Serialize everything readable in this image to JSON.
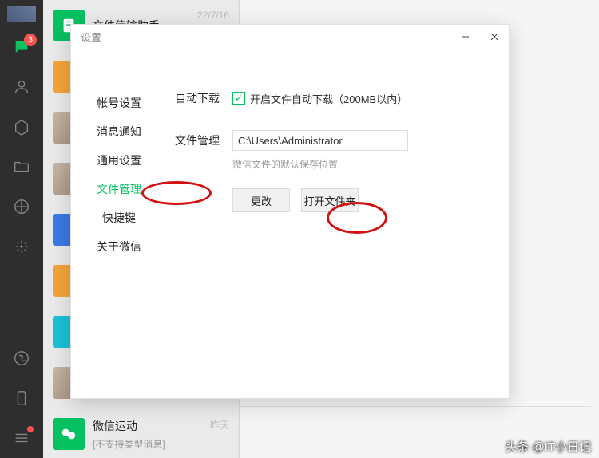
{
  "rail": {
    "badge": "3"
  },
  "chat_list": [
    {
      "name": "文件传输助手",
      "time": "22/7/16"
    },
    {
      "name": "微信运动",
      "sub": "[不支持类型消息]",
      "time": "昨天"
    }
  ],
  "settings": {
    "title": "设置",
    "nav": [
      "帐号设置",
      "消息通知",
      "通用设置",
      "文件管理",
      "快捷键",
      "关于微信"
    ],
    "active_nav": 3,
    "auto_download": {
      "label": "自动下载",
      "text": "开启文件自动下载（200MB以内）",
      "checked": true
    },
    "file_manage": {
      "label": "文件管理",
      "path": "C:\\Users\\Administrator",
      "hint": "微信文件的默认保存位置",
      "change_btn": "更改",
      "open_btn": "打开文件夹"
    }
  },
  "watermark": "头条 @IT小日记"
}
